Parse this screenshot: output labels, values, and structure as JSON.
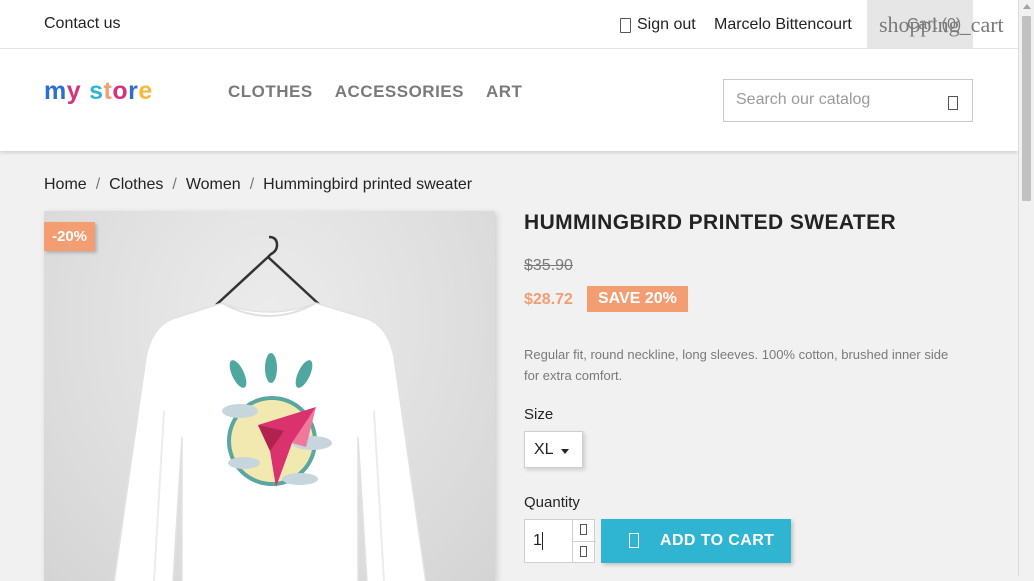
{
  "topbar": {
    "contact_label": "Contact us",
    "signout_label": "Sign out",
    "user_name": "Marcelo Bittencourt",
    "cart_icon_text": "shopping_cart",
    "cart_label": "Cart (0)"
  },
  "header": {
    "logo_letters": [
      "m",
      "y",
      " ",
      "s",
      "t",
      "o",
      "r",
      "e"
    ],
    "logo_text": "my store",
    "nav": [
      "CLOTHES",
      "ACCESSORIES",
      "ART"
    ],
    "search_placeholder": "Search our catalog",
    "search_icon": "search-icon"
  },
  "breadcrumb": [
    "Home",
    "Clothes",
    "Women",
    "Hummingbird printed sweater"
  ],
  "product": {
    "discount_flag": "-20%",
    "title": "HUMMINGBIRD PRINTED SWEATER",
    "old_price": "$35.90",
    "new_price": "$28.72",
    "save_label": "SAVE 20%",
    "description": "Regular fit, round neckline, long sleeves. 100% cotton, brushed inner side for extra comfort.",
    "size_label": "Size",
    "size_value": "XL",
    "quantity_label": "Quantity",
    "quantity_value": "1",
    "add_to_cart_label": "ADD TO CART"
  },
  "colors": {
    "accent": "#2fb5d2",
    "discount": "#f39d72",
    "text": "#232323",
    "muted": "#7a7a7a"
  }
}
